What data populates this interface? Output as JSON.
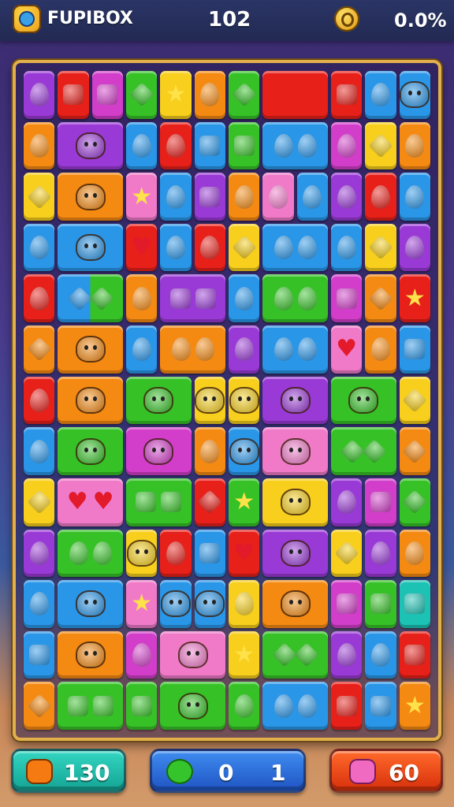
{
  "header": {
    "app_title": "FUPIBOX",
    "score": "102",
    "percent": "0.0%",
    "logo_icon": "game-logo-icon",
    "coin_icon": "coin-icon"
  },
  "board": {
    "rows": [
      [
        "purple-drop",
        "red-square",
        "magenta-square",
        "green-diamond",
        "yellow-star",
        "orange-drop",
        "green-diamond",
        "red-capsule-wide",
        "red-square",
        "blue-drop",
        "blue-critter"
      ],
      [
        "orange-drop",
        "purple-critter-wide",
        "blue-drop",
        "red-drop",
        "blue-square",
        "green-square",
        "blue-drop-wide",
        "magenta-drop",
        "yellow-diamond",
        "orange-drop"
      ],
      [
        "yellow-diamond",
        "orange-critter-wide",
        "pink-star",
        "blue-drop",
        "purple-square",
        "orange-drop",
        "pink-drop",
        "blue-drop",
        "purple-drop",
        "red-drop",
        "blue-drop"
      ],
      [
        "blue-drop",
        "blue-critter-wide",
        "red-heart",
        "blue-drop",
        "red-drop",
        "yellow-diamond",
        "blue-drop-wide",
        "blue-drop",
        "yellow-diamond",
        "purple-drop"
      ],
      [
        "red-drop",
        "blue-green-wide",
        "orange-drop",
        "purple-square-wide",
        "blue-drop",
        "green-drop-wide",
        "magenta-square",
        "orange-diamond",
        "red-star"
      ],
      [
        "orange-diamond",
        "orange-critter-wide",
        "blue-drop",
        "orange-drop-wide",
        "purple-drop",
        "blue-drop-wide",
        "pink-heart",
        "orange-drop",
        "blue-square"
      ],
      [
        "red-drop",
        "orange-critter-wide",
        "green-critter-wide",
        "yellow-critter",
        "yellow-critter",
        "purple-critter-wide",
        "green-critter-wide",
        "yellow-diamond"
      ],
      [
        "blue-drop",
        "green-critter-wide",
        "magenta-critter-wide",
        "orange-drop",
        "blue-critter",
        "pink-critter-wide",
        "green-diamond-wide",
        "orange-diamond"
      ],
      [
        "yellow-diamond",
        "pink-heart-wide",
        "green-square-wide",
        "red-diamond",
        "green-star",
        "yellow-critter-wide",
        "purple-drop",
        "magenta-square",
        "green-diamond"
      ],
      [
        "purple-drop",
        "green-drop-wide",
        "yellow-critter",
        "red-drop",
        "blue-square",
        "red-heart",
        "purple-critter-wide",
        "yellow-diamond",
        "purple-drop",
        "orange-drop"
      ],
      [
        "blue-drop",
        "blue-critter-wide",
        "pink-star",
        "blue-critter",
        "blue-critter",
        "yellow-drop",
        "orange-critter-wide",
        "magenta-square",
        "green-square",
        "teal-square"
      ],
      [
        "blue-square",
        "orange-critter-wide",
        "magenta-drop",
        "pink-critter-wide",
        "yellow-star",
        "green-diamond-wide",
        "purple-drop",
        "blue-drop",
        "red-square"
      ],
      [
        "orange-diamond",
        "green-square-wide",
        "green-square",
        "green-critter-wide",
        "green-drop",
        "blue-drop-wide",
        "red-square",
        "blue-square",
        "orange-star"
      ]
    ]
  },
  "footer": {
    "left_value": "130",
    "left_icon": "orange-monster-icon",
    "center_moves": "0",
    "center_level": "1",
    "center_icon": "green-star-icon",
    "right_value": "60",
    "right_icon": "pink-creature-icon"
  },
  "colors": {
    "red": "#e8201a",
    "orange": "#f58a12",
    "yellow": "#f7cf1c",
    "green": "#36c227",
    "blue": "#2a96e8",
    "purple": "#9a3ad6",
    "magenta": "#d23ec9",
    "pink": "#f07ac8",
    "teal": "#1cc2b4",
    "board_border": "#e2b04a",
    "footer_left": "#1bb7a6",
    "footer_center": "#2765d8",
    "footer_right": "#f04a1a"
  }
}
